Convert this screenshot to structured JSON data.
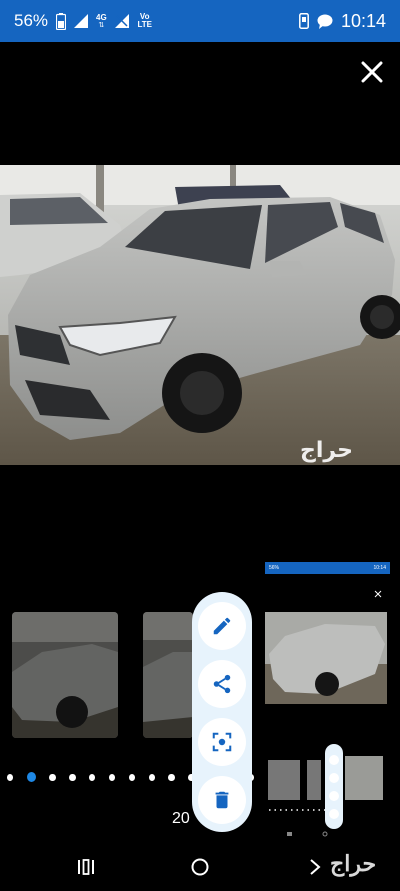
{
  "status_bar": {
    "battery_percent": "56%",
    "network_4g": "4G",
    "network_volte": "Vo LTE",
    "time": "10:14"
  },
  "viewer": {
    "watermark_text": "حراج",
    "counter_text": "20"
  },
  "mini_preview": {
    "status_text": "56%",
    "time": "10:14"
  },
  "carousel": {
    "dot_count": 13,
    "active_index": 1
  },
  "actions": {
    "edit": "edit-icon",
    "share": "share-icon",
    "lens": "lens-icon",
    "delete": "delete-icon"
  },
  "nav": {
    "recents": "recents-icon",
    "home": "home-icon",
    "back": "back-icon"
  },
  "colors": {
    "status_bar": "#1565c0",
    "accent": "#1e88e5",
    "fab_menu_bg": "#e7f3fc",
    "icon_color": "#1565c0"
  }
}
